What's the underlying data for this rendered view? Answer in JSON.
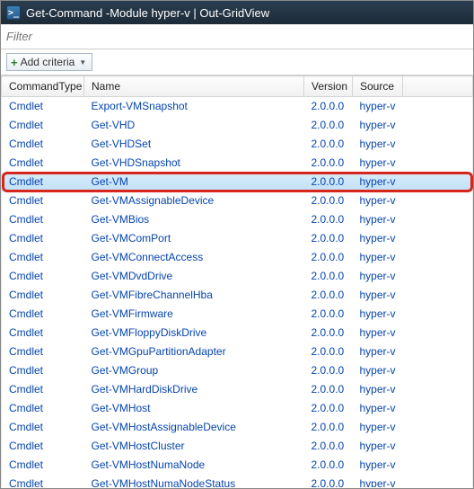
{
  "window": {
    "title": "Get-Command -Module hyper-v | Out-GridView"
  },
  "filter": {
    "placeholder": "Filter"
  },
  "toolbar": {
    "add_criteria": "Add criteria"
  },
  "columns": {
    "commandtype": "CommandType",
    "name": "Name",
    "version": "Version",
    "source": "Source"
  },
  "rows": [
    {
      "type": "Cmdlet",
      "name": "Export-VMSnapshot",
      "version": "2.0.0.0",
      "source": "hyper-v",
      "hl": false
    },
    {
      "type": "Cmdlet",
      "name": "Get-VHD",
      "version": "2.0.0.0",
      "source": "hyper-v",
      "hl": false
    },
    {
      "type": "Cmdlet",
      "name": "Get-VHDSet",
      "version": "2.0.0.0",
      "source": "hyper-v",
      "hl": false
    },
    {
      "type": "Cmdlet",
      "name": "Get-VHDSnapshot",
      "version": "2.0.0.0",
      "source": "hyper-v",
      "hl": false
    },
    {
      "type": "Cmdlet",
      "name": "Get-VM",
      "version": "2.0.0.0",
      "source": "hyper-v",
      "hl": true
    },
    {
      "type": "Cmdlet",
      "name": "Get-VMAssignableDevice",
      "version": "2.0.0.0",
      "source": "hyper-v",
      "hl": false
    },
    {
      "type": "Cmdlet",
      "name": "Get-VMBios",
      "version": "2.0.0.0",
      "source": "hyper-v",
      "hl": false
    },
    {
      "type": "Cmdlet",
      "name": "Get-VMComPort",
      "version": "2.0.0.0",
      "source": "hyper-v",
      "hl": false
    },
    {
      "type": "Cmdlet",
      "name": "Get-VMConnectAccess",
      "version": "2.0.0.0",
      "source": "hyper-v",
      "hl": false
    },
    {
      "type": "Cmdlet",
      "name": "Get-VMDvdDrive",
      "version": "2.0.0.0",
      "source": "hyper-v",
      "hl": false
    },
    {
      "type": "Cmdlet",
      "name": "Get-VMFibreChannelHba",
      "version": "2.0.0.0",
      "source": "hyper-v",
      "hl": false
    },
    {
      "type": "Cmdlet",
      "name": "Get-VMFirmware",
      "version": "2.0.0.0",
      "source": "hyper-v",
      "hl": false
    },
    {
      "type": "Cmdlet",
      "name": "Get-VMFloppyDiskDrive",
      "version": "2.0.0.0",
      "source": "hyper-v",
      "hl": false
    },
    {
      "type": "Cmdlet",
      "name": "Get-VMGpuPartitionAdapter",
      "version": "2.0.0.0",
      "source": "hyper-v",
      "hl": false
    },
    {
      "type": "Cmdlet",
      "name": "Get-VMGroup",
      "version": "2.0.0.0",
      "source": "hyper-v",
      "hl": false
    },
    {
      "type": "Cmdlet",
      "name": "Get-VMHardDiskDrive",
      "version": "2.0.0.0",
      "source": "hyper-v",
      "hl": false
    },
    {
      "type": "Cmdlet",
      "name": "Get-VMHost",
      "version": "2.0.0.0",
      "source": "hyper-v",
      "hl": false
    },
    {
      "type": "Cmdlet",
      "name": "Get-VMHostAssignableDevice",
      "version": "2.0.0.0",
      "source": "hyper-v",
      "hl": false
    },
    {
      "type": "Cmdlet",
      "name": "Get-VMHostCluster",
      "version": "2.0.0.0",
      "source": "hyper-v",
      "hl": false
    },
    {
      "type": "Cmdlet",
      "name": "Get-VMHostNumaNode",
      "version": "2.0.0.0",
      "source": "hyper-v",
      "hl": false
    },
    {
      "type": "Cmdlet",
      "name": "Get-VMHostNumaNodeStatus",
      "version": "2.0.0.0",
      "source": "hyper-v",
      "hl": false
    }
  ]
}
